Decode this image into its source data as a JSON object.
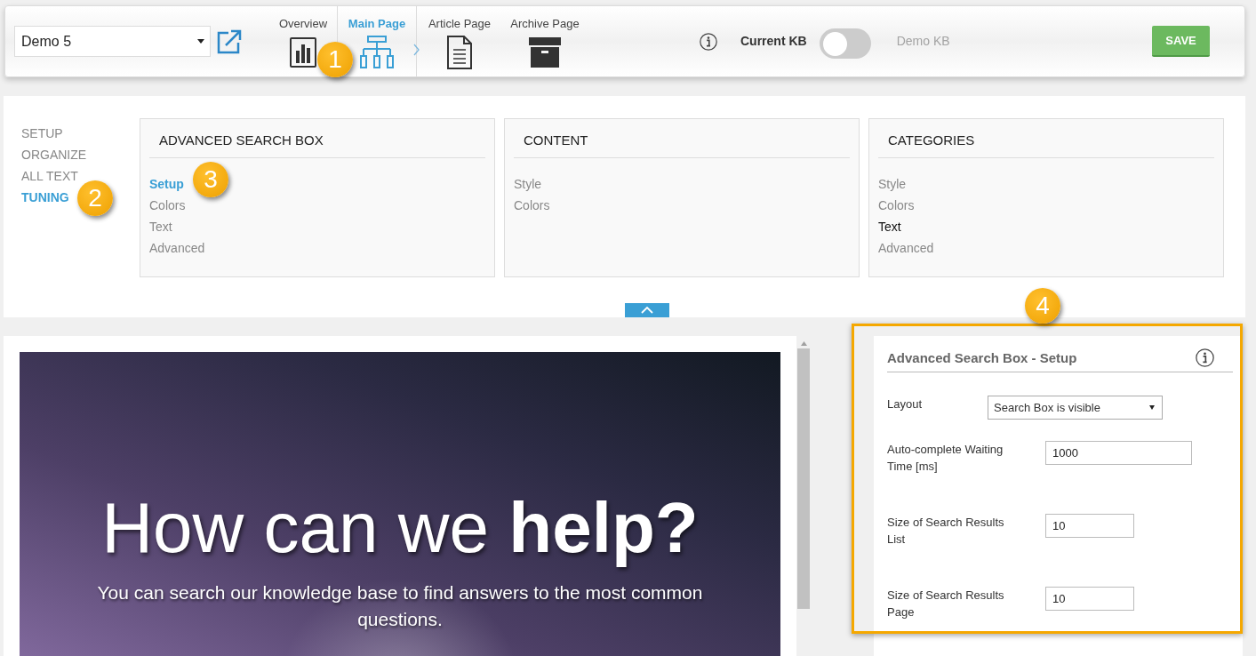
{
  "toolbar": {
    "kb_select": {
      "value": "Demo 5"
    },
    "tabs": [
      {
        "label": "Overview",
        "kind": "chart",
        "selected": false
      },
      {
        "label": "Main Page",
        "kind": "sitemap",
        "selected": true
      },
      {
        "label": "Article Page",
        "kind": "document",
        "selected": false
      },
      {
        "label": "Archive Page",
        "kind": "archive",
        "selected": false
      }
    ],
    "callout": "1",
    "kb_switch": {
      "label_current": "Current KB",
      "on": false,
      "label_demo": "Demo KB"
    },
    "save_button": "SAVE"
  },
  "settings": {
    "nav": [
      {
        "label": "SETUP",
        "selected": false
      },
      {
        "label": "ORGANIZE",
        "selected": false
      },
      {
        "label": "ALL TEXT",
        "selected": false
      },
      {
        "label": "TUNING",
        "selected": true
      }
    ],
    "nav_callout": "2",
    "cards": [
      {
        "title": "ADVANCED SEARCH BOX",
        "callout": "3",
        "items": [
          {
            "label": "Setup",
            "selected": true,
            "hovered": false
          },
          {
            "label": "Colors",
            "selected": false,
            "hovered": false
          },
          {
            "label": "Text",
            "selected": false,
            "hovered": false
          },
          {
            "label": "Advanced",
            "selected": false,
            "hovered": false
          }
        ]
      },
      {
        "title": "CONTENT",
        "items": [
          {
            "label": "Style",
            "selected": false,
            "hovered": false
          },
          {
            "label": "Colors",
            "selected": false,
            "hovered": false
          }
        ]
      },
      {
        "title": "CATEGORIES",
        "items": [
          {
            "label": "Style",
            "selected": false,
            "hovered": false
          },
          {
            "label": "Colors",
            "selected": false,
            "hovered": false
          },
          {
            "label": "Text",
            "selected": false,
            "hovered": true
          },
          {
            "label": "Advanced",
            "selected": false,
            "hovered": false
          }
        ]
      }
    ]
  },
  "preview": {
    "heading": "How can we **help?**",
    "subtitle": "You can search our knowledge base to find answers to the most common questions."
  },
  "setup_panel": {
    "highlighted": true,
    "callout": "4",
    "title": "Advanced Search Box - Setup",
    "fields": [
      {
        "label": "Layout",
        "kind": "select",
        "value": "Search Box is visible"
      },
      {
        "label": "Auto-complete Waiting Time [ms]",
        "kind": "text",
        "value": "1000"
      },
      {
        "label": "Size of Search Results List",
        "kind": "number",
        "value": "10"
      },
      {
        "label": "Size of Search Results Page",
        "kind": "number",
        "value": "10"
      }
    ]
  }
}
